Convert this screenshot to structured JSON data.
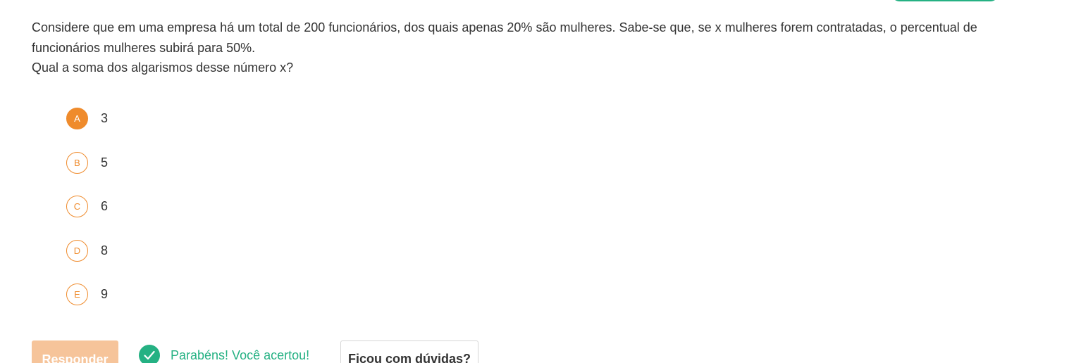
{
  "question": {
    "line1": "Considere que em uma empresa há um total de 200 funcionários, dos quais apenas 20% são mulheres. Sabe-se que, se x mulheres forem contratadas, o percentual de funcionários mulheres subirá para 50%.",
    "line2": "Qual a soma dos algarismos desse número x?"
  },
  "options": [
    {
      "letter": "A",
      "text": "3",
      "selected": true
    },
    {
      "letter": "B",
      "text": "5",
      "selected": false
    },
    {
      "letter": "C",
      "text": "6",
      "selected": false
    },
    {
      "letter": "D",
      "text": "8",
      "selected": false
    },
    {
      "letter": "E",
      "text": "9",
      "selected": false
    }
  ],
  "actions": {
    "respond_label": "Responder",
    "success_message": "Parabéns! Você acertou!",
    "doubts_label": "Ficou com dúvidas?"
  },
  "colors": {
    "accent_orange": "#ef8b2c",
    "success_green": "#25b183",
    "disabled_orange": "#f6c49a"
  },
  "icons": {
    "success": "check-circle-icon"
  }
}
